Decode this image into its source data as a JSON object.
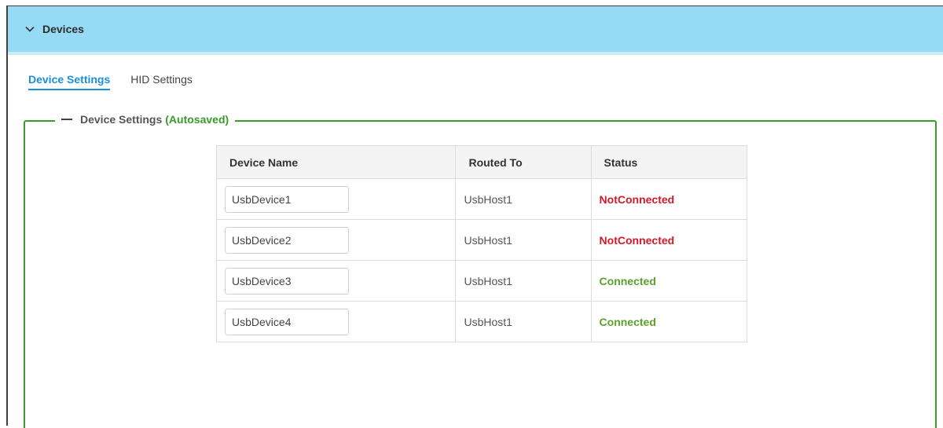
{
  "header": {
    "title": "Devices",
    "icon": "chevron-down-icon"
  },
  "tabs": [
    {
      "label": "Device Settings",
      "active": true
    },
    {
      "label": "HID Settings",
      "active": false
    }
  ],
  "section": {
    "title": "Device Settings",
    "status": "(Autosaved)",
    "accent": "#3a9a2c"
  },
  "table": {
    "columns": [
      "Device Name",
      "Routed To",
      "Status"
    ],
    "rows": [
      {
        "name": "UsbDevice1",
        "routed_to": "UsbHost1",
        "status": "NotConnected",
        "status_color": "#d11a2a"
      },
      {
        "name": "UsbDevice2",
        "routed_to": "UsbHost1",
        "status": "NotConnected",
        "status_color": "#d11a2a"
      },
      {
        "name": "UsbDevice3",
        "routed_to": "UsbHost1",
        "status": "Connected",
        "status_color": "#5ba12b"
      },
      {
        "name": "UsbDevice4",
        "routed_to": "UsbHost1",
        "status": "Connected",
        "status_color": "#5ba12b"
      }
    ]
  }
}
